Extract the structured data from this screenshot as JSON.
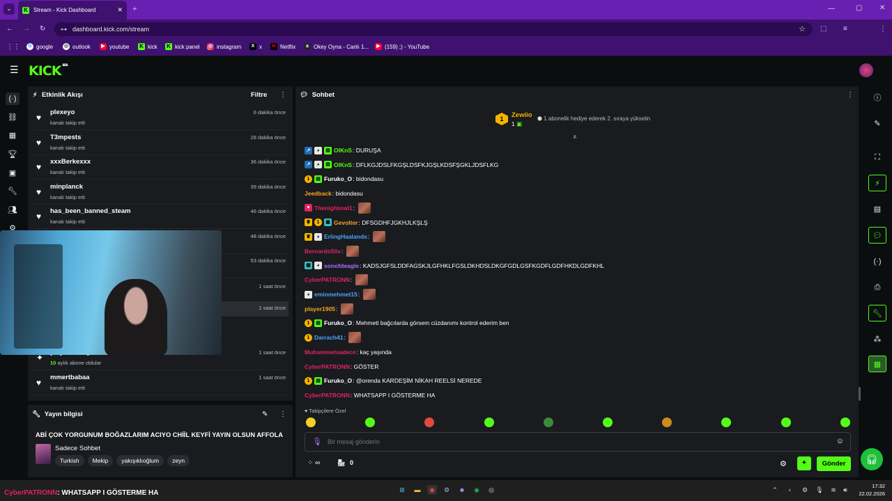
{
  "browser": {
    "tab_title": "Stream - Kick Dashboard",
    "url": "dashboard.kick.com/stream",
    "profile_initial": "Z",
    "bookmarks": [
      "google",
      "outlook",
      "youtube",
      "kick",
      "kick panel",
      "instagram",
      "x",
      "Netflix",
      "Okey Oyna - Canlı 1...",
      "(159) ;) - YouTube"
    ]
  },
  "app": {
    "logo": "KICK",
    "logo_badge": "BETA"
  },
  "activity": {
    "title": "Etkinlik Akışı",
    "filter_label": "Filtre",
    "items": [
      {
        "name": "plexeyo",
        "sub": "kanalı takip etti",
        "time": "6 dakika önce"
      },
      {
        "name": "T3mpests",
        "sub": "kanalı takip etti",
        "time": "28 dakika önce"
      },
      {
        "name": "xxxBerkexxx",
        "sub": "kanalı takip etti",
        "time": "36 dakika önce"
      },
      {
        "name": "minplanck",
        "sub": "kanalı takip etti",
        "time": "39 dakika önce"
      },
      {
        "name": "has_been_banned_steam",
        "sub": "kanalı takip etti",
        "time": "46 dakika önce"
      },
      {
        "name": "",
        "sub": "",
        "time": "48 dakika önce"
      },
      {
        "name": "",
        "sub": "",
        "time": "53 dakika önce"
      },
      {
        "name": "",
        "sub": "",
        "time": "1 saat önce"
      },
      {
        "name": "",
        "sub": "",
        "time": "1 saat önce"
      },
      {
        "name": "ysfyldrm56 yeniden abone oldu!",
        "sub_count": "10",
        "sub": "aylık abone oldular",
        "time": "1 saat önce"
      },
      {
        "name": "mmertbabaa",
        "sub": "kanalı takip etti",
        "time": "1 saat önce"
      }
    ]
  },
  "stream_info": {
    "title": "Yayın bilgisi",
    "stream_title": "ABİ ÇOK YORGUNUM BOĞAZLARIM ACIYO CHİİL KEYFİ YAYIN OLSUN AFFOLA",
    "category": "Sadece Sohbet",
    "tags": [
      "Turkish",
      "Mekip",
      "yakışıklıoğlum",
      "zeyn"
    ]
  },
  "chat": {
    "title": "Sohbet",
    "top_gifter": {
      "name": "Zewiio",
      "rank": "1",
      "count": "1",
      "note": "1 abonelik hediye ederek 2. sıraya yükselin"
    },
    "messages": [
      {
        "user": "OlKnS",
        "color": "#53fc18",
        "badges": [
          "mod",
          "bot",
          "sub"
        ],
        "text": "DURUŞA",
        "emotes": 0
      },
      {
        "user": "OlKnS",
        "color": "#53fc18",
        "badges": [
          "mod",
          "bot",
          "sub"
        ],
        "text": "DFLKGJDSLFKGŞLDSFKJGŞLKDSFŞGKLJDSFLKG",
        "emotes": 0
      },
      {
        "user": "Furuko_O",
        "color": "#ffffff",
        "badges": [
          "gold",
          "sub"
        ],
        "text": "bidondasu",
        "emotes": 0
      },
      {
        "user": "Jeedback",
        "color": "#f5a623",
        "badges": [],
        "text": "bidondasu",
        "emotes": 0
      },
      {
        "user": "Thenightowl1",
        "color": "#e0245e",
        "badges": [
          "heart"
        ],
        "text": "",
        "emotes": 1
      },
      {
        "user": "Gevolter",
        "color": "#f5a623",
        "badges": [
          "crown",
          "gold",
          "gift"
        ],
        "text": "DFSGDHFJGKHJLKŞLŞ",
        "emotes": 0
      },
      {
        "user": "ErlingHaalands",
        "color": "#4aa3ff",
        "badges": [
          "crown",
          "bot"
        ],
        "text": "",
        "emotes": 1
      },
      {
        "user": "Bernardo5liv",
        "color": "#e0245e",
        "badges": [],
        "text": "",
        "emotes": 1
      },
      {
        "user": "sonofdeagle",
        "color": "#b06bff",
        "badges": [
          "qr",
          "bot"
        ],
        "text": "KADSJGFSLDDFAGSKJLGFHKLFGSLDKHDSLDKGFGDLGSFKGDFLGDFHKDLGDFKHL",
        "emotes": 0
      },
      {
        "user": "CyberPATRONN",
        "color": "#e0245e",
        "badges": [],
        "text": "",
        "emotes": 1
      },
      {
        "user": "eminmehmet15",
        "color": "#4aa3ff",
        "badges": [
          "bot"
        ],
        "text": "",
        "emotes": 1
      },
      {
        "user": "player1905",
        "color": "#f5a623",
        "badges": [],
        "text": "",
        "emotes": 1
      },
      {
        "user": "Furuko_O",
        "color": "#ffffff",
        "badges": [
          "gold",
          "sub"
        ],
        "text": "Mehmeti bağcılarda görsem cüzdanımı kontrol ederim ben",
        "emotes": 0
      },
      {
        "user": "Darrach41",
        "color": "#4aa3ff",
        "badges": [
          "gold"
        ],
        "text": "",
        "emotes": 1
      },
      {
        "user": "Muhammetsadece",
        "color": "#e0245e",
        "badges": [],
        "text": "kaç yaşında",
        "emotes": 0
      },
      {
        "user": "CyberPATRONN",
        "color": "#e0245e",
        "badges": [],
        "text": "GÖSTER",
        "emotes": 0
      },
      {
        "user": "Furuko_O",
        "color": "#ffffff",
        "badges": [
          "gold",
          "sub"
        ],
        "text": "@orenda KARDEŞİM NİKAH REELSİ NEREDE",
        "emotes": 0
      },
      {
        "user": "CyberPATRONN",
        "color": "#e0245e",
        "badges": [],
        "text": "WHATSAPP I GÖSTERME HA",
        "emotes": 0
      }
    ],
    "followers_only_label": "Takipçilere Özel",
    "input_placeholder": "Bir mesaj gönderin",
    "points_label": "∞",
    "store_count": "0",
    "send_label": "Gönder"
  },
  "overlay_message": {
    "user": "CyberPATRONN",
    "text": ": WHATSAPP I GÖSTERME HA"
  },
  "taskbar": {
    "time": "17:32",
    "date": "22.02.2026"
  },
  "colors": {
    "kick_green": "#53fc18",
    "panel": "#191b1f",
    "bg": "#0b0e0f",
    "chrome_purple": "#6a1fb3"
  }
}
